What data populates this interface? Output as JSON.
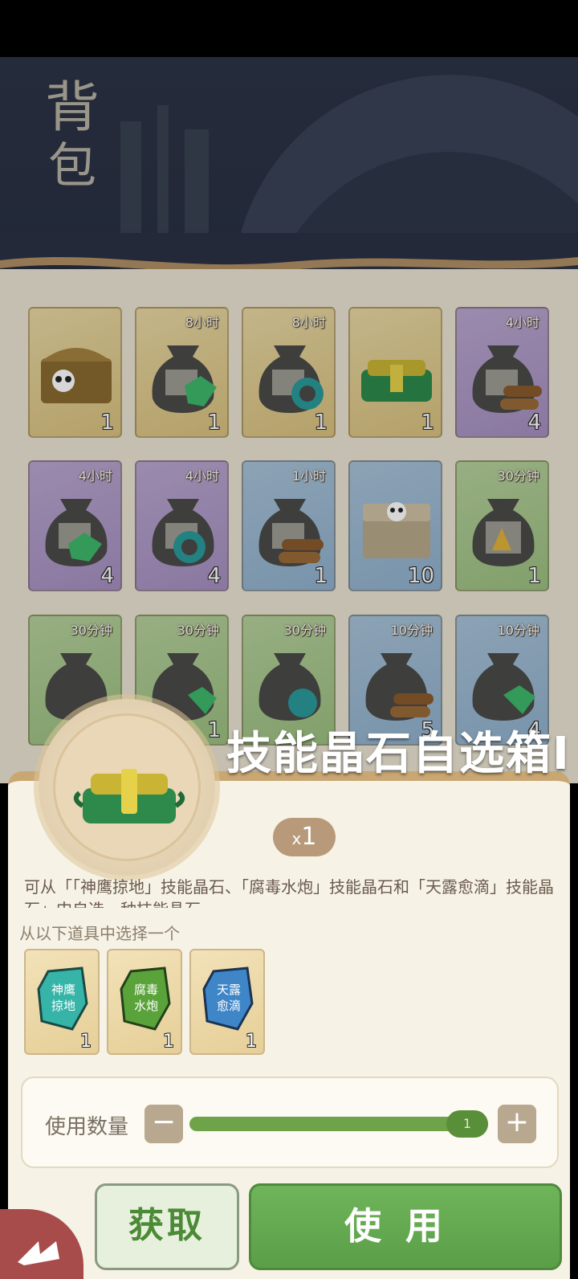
{
  "header": {
    "title_line1": "背",
    "title_line2": "包"
  },
  "grid": {
    "row1": [
      {
        "timer": "",
        "qty": "1",
        "color": "gold",
        "icon": "panda-chest-icon"
      },
      {
        "timer": "8小时",
        "qty": "1",
        "color": "gold",
        "icon": "sack-green-crystal-icon"
      },
      {
        "timer": "8小时",
        "qty": "1",
        "color": "gold",
        "icon": "sack-teal-crystal-icon"
      },
      {
        "timer": "",
        "qty": "1",
        "color": "gold",
        "icon": "jade-chest-icon"
      },
      {
        "timer": "4小时",
        "qty": "4",
        "color": "purple",
        "icon": "sack-wood-icon"
      }
    ],
    "row2": [
      {
        "timer": "4小时",
        "qty": "4",
        "color": "purple",
        "icon": "sack-green-crystal-icon"
      },
      {
        "timer": "4小时",
        "qty": "4",
        "color": "purple",
        "icon": "sack-teal-crystal-icon"
      },
      {
        "timer": "1小时",
        "qty": "1",
        "color": "blue",
        "icon": "sack-wood-icon"
      },
      {
        "timer": "",
        "qty": "10",
        "color": "blue",
        "icon": "panda-crate-icon"
      },
      {
        "timer": "30分钟",
        "qty": "1",
        "color": "green",
        "icon": "sack-gold-icon"
      }
    ],
    "row3": [
      {
        "timer": "30分钟",
        "qty": "",
        "color": "green",
        "icon": "sack-wood-icon"
      },
      {
        "timer": "30分钟",
        "qty": "1",
        "color": "green",
        "icon": "sack-green-crystal-icon"
      },
      {
        "timer": "30分钟",
        "qty": "",
        "color": "green",
        "icon": "sack-teal-crystal-icon"
      },
      {
        "timer": "10分钟",
        "qty": "5",
        "color": "blue",
        "icon": "sack-wood-icon"
      },
      {
        "timer": "10分钟",
        "qty": "4",
        "color": "blue",
        "icon": "sack-green-crystal-icon"
      }
    ]
  },
  "detail": {
    "item_name": "技能晶石自选箱I",
    "qty_prefix": "x",
    "qty": "1",
    "description": "可从「「神鹰掠地」技能晶石、「腐毒水炮」技能晶石和「天露愈滴」技能晶石」中自选一种技能晶石",
    "choose_label": "从以下道具中选择一个",
    "options": [
      {
        "name_line1": "神鹰",
        "name_line2": "掠地",
        "qty": "1",
        "color": "#36b4a8"
      },
      {
        "name_line1": "腐毒",
        "name_line2": "水炮",
        "qty": "1",
        "color": "#5aa33a"
      },
      {
        "name_line1": "天露",
        "name_line2": "愈滴",
        "qty": "1",
        "color": "#3f86c8"
      }
    ],
    "use_count_label": "使用数量",
    "minus": "−",
    "plus": "+",
    "slider_value": "1",
    "get_button": "获取",
    "use_button": "使用"
  },
  "colors": {
    "accent_green": "#5a9f48",
    "panel_border": "#c9a773",
    "header_bg": "#2c3446"
  }
}
